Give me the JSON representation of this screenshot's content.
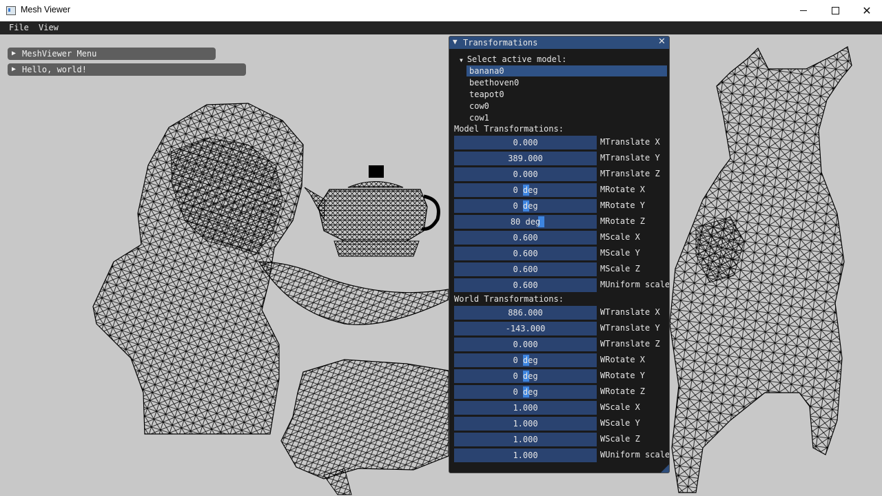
{
  "window": {
    "title": "Mesh Viewer",
    "controls": {
      "minimize": "─",
      "maximize": "☐",
      "close": "✕"
    }
  },
  "menubar": {
    "items": [
      "File",
      "View"
    ]
  },
  "collapsed_windows": [
    {
      "label": "MeshViewer Menu",
      "arrow": "▶"
    },
    {
      "label": "Hello, world!",
      "arrow": "▶"
    }
  ],
  "transformations": {
    "title": "Transformations",
    "title_arrow": "▼",
    "close_icon": "✕",
    "select_header": "Select active model:",
    "select_arrow": "▼",
    "models": [
      "banana0",
      "beethoven0",
      "teapot0",
      "cow0",
      "cow1"
    ],
    "active_model": "banana0",
    "model_section": "Model Transformations:",
    "model_rows": [
      {
        "value": "0.000",
        "label": "MTranslate X"
      },
      {
        "value": "389.000",
        "label": "MTranslate Y"
      },
      {
        "value": "0.000",
        "label": "MTranslate Z"
      },
      {
        "value": "0 deg",
        "label": "MRotate X"
      },
      {
        "value": "0 deg",
        "label": "MRotate Y"
      },
      {
        "value": "80 deg",
        "label": "MRotate Z"
      },
      {
        "value": "0.600",
        "label": "MScale X"
      },
      {
        "value": "0.600",
        "label": "MScale Y"
      },
      {
        "value": "0.600",
        "label": "MScale Z"
      },
      {
        "value": "0.600",
        "label": "MUniform scale"
      }
    ],
    "world_section": "World Transformations:",
    "world_rows": [
      {
        "value": "886.000",
        "label": "WTranslate X"
      },
      {
        "value": "-143.000",
        "label": "WTranslate Y"
      },
      {
        "value": "0.000",
        "label": "WTranslate Z"
      },
      {
        "value": "0 deg",
        "label": "WRotate X"
      },
      {
        "value": "0 deg",
        "label": "WRotate Y"
      },
      {
        "value": "0 deg",
        "label": "WRotate Z"
      },
      {
        "value": "1.000",
        "label": "WScale X"
      },
      {
        "value": "1.000",
        "label": "WScale Y"
      },
      {
        "value": "1.000",
        "label": "WScale Z"
      },
      {
        "value": "1.000",
        "label": "WUniform scale"
      }
    ]
  },
  "colors": {
    "viewport_bg": "#c8c8c8",
    "title_active": "#2d4d7c",
    "field_bg": "#2a4370",
    "selection": "#2f5286",
    "slider_grab": "#3d85e0",
    "wireframe": "#000000"
  }
}
